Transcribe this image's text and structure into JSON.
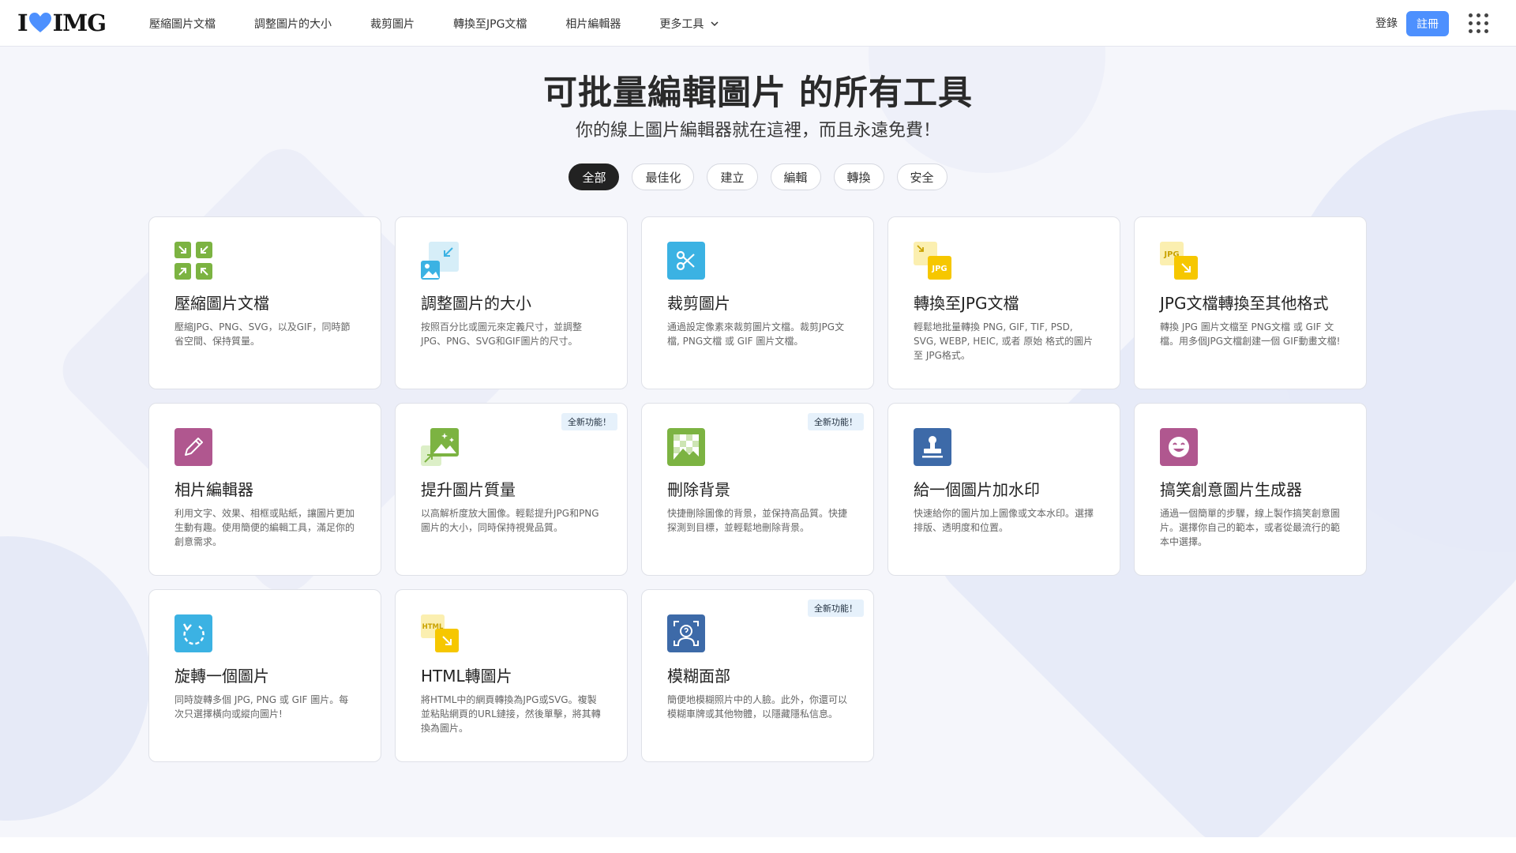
{
  "brand": {
    "logo_left": "I",
    "logo_right": "IMG"
  },
  "nav": {
    "items": [
      "壓縮圖片文檔",
      "調整圖片的大小",
      "裁剪圖片",
      "轉換至JPG文檔",
      "相片編輯器",
      "更多工具"
    ]
  },
  "header": {
    "login": "登錄",
    "signup": "註冊"
  },
  "hero": {
    "title": "可批量編輯圖片 的所有工具",
    "subtitle": "你的線上圖片編輯器就在這裡，而且永遠免費！"
  },
  "filters": [
    "全部",
    "最佳化",
    "建立",
    "編輯",
    "轉換",
    "安全"
  ],
  "tools": [
    {
      "title": "壓縮圖片文檔",
      "desc": "壓縮JPG、PNG、SVG，以及GIF，同時節省空間、保持質量。",
      "icon": "compress-icon",
      "badge": ""
    },
    {
      "title": "調整圖片的大小",
      "desc": "按照百分比或圖元來定義尺寸，並調整JPG、PNG、SVG和GIF圖片的尺寸。",
      "icon": "resize-icon",
      "badge": ""
    },
    {
      "title": "裁剪圖片",
      "desc": "通過設定像素來裁剪圖片文檔。裁剪JPG文檔, PNG文檔 或 GIF 圖片文檔。",
      "icon": "scissors-icon",
      "badge": ""
    },
    {
      "title": "轉換至JPG文檔",
      "desc": "輕鬆地批量轉換 PNG, GIF, TIF, PSD, SVG, WEBP, HEIC, 或者 原始 格式的圖片至 JPG格式。",
      "icon": "to-jpg-icon",
      "badge": ""
    },
    {
      "title": "JPG文檔轉換至其他格式",
      "desc": "轉換 JPG 圖片文檔至 PNG文檔 或 GIF 文檔。用多個JPG文檔創建一個 GIF動畫文檔!",
      "icon": "from-jpg-icon",
      "badge": ""
    },
    {
      "title": "相片編輯器",
      "desc": "利用文字、效果、相框或貼紙，讓圖片更加生動有趣。使用簡便的編輯工具，滿足你的創意需求。",
      "icon": "pencil-icon",
      "badge": ""
    },
    {
      "title": "提升圖片質量",
      "desc": "以高解析度放大圖像。輕鬆提升JPG和PNG圖片的大小，同時保持視覺品質。",
      "icon": "upscale-icon",
      "badge": "全新功能！"
    },
    {
      "title": "刪除背景",
      "desc": "快捷刪除圖像的背景，並保持高品質。快捷探測到目標，並輕鬆地刪除背景。",
      "icon": "remove-bg-icon",
      "badge": "全新功能！"
    },
    {
      "title": "給一個圖片加水印",
      "desc": "快速給你的圖片加上圖像或文本水印。選擇排版、透明度和位置。",
      "icon": "stamp-icon",
      "badge": ""
    },
    {
      "title": "搞笑創意圖片生成器",
      "desc": "通過一個簡單的步驟，線上製作搞笑創意圖片。選擇你自己的範本，或者從最流行的範本中選擇。",
      "icon": "meme-icon",
      "badge": ""
    },
    {
      "title": "旋轉一個圖片",
      "desc": "同時旋轉多個 JPG, PNG 或 GIF 圖片。每次只選擇橫向或縱向圖片!",
      "icon": "rotate-icon",
      "badge": ""
    },
    {
      "title": "HTML轉圖片",
      "desc": "將HTML中的網頁轉換為JPG或SVG。複製並粘貼網頁的URL鏈接，然後單擊，將其轉換為圖片。",
      "icon": "html-icon",
      "badge": ""
    },
    {
      "title": "模糊面部",
      "desc": "簡便地模糊照片中的人臉。此外，你還可以模糊車牌或其他物體，以隱藏隱私信息。",
      "icon": "blur-face-icon",
      "badge": "全新功能！"
    }
  ],
  "colors": {
    "accent": "#4d90fe",
    "green": "#7cb342",
    "sky": "#3bb2e3",
    "yellow": "#f6c700",
    "purple": "#b0578f",
    "navy": "#3d6aa8"
  }
}
